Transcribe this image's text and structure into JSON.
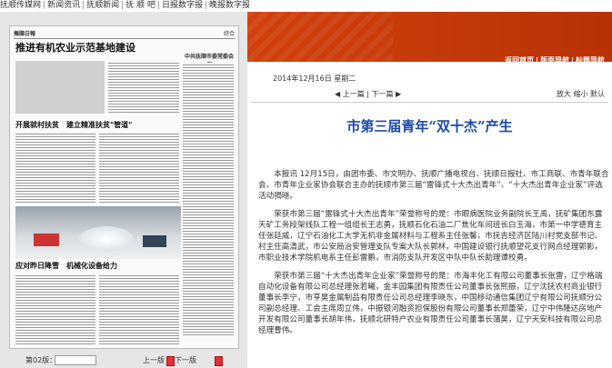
{
  "top_nav": [
    "抚顺传媒网",
    "新闻资讯",
    "抚顺新闻",
    "抚 顺 吧",
    "日报数字报",
    "晚报数字报"
  ],
  "paper_preview": {
    "masthead": "撫順日報",
    "section": "综合",
    "headline_main": "推进有机农业示范基地建设",
    "headline_mid": "开展就村扶贫　建立精准扶贫\"管道\"",
    "headline_photo": "应对昨日降雪　机械化设备给力",
    "side_headline": "中共抚顺市委常委会议"
  },
  "page_nav": {
    "page_label": "第02版：",
    "prev": "上一版",
    "next": "下一版"
  },
  "header_nav": [
    "返回首页",
    "版面导航",
    "标题导航"
  ],
  "article": {
    "date": "2014年12月16日 星期二",
    "prev": "上一篇",
    "next": "下一篇",
    "tools": "放大 缩小 默认",
    "title": "市第三届青年“双十杰”产生",
    "paragraphs": [
      "本报讯 12月15日，由团市委、市文明办、抚顺广播电视台、抚顺日报社、市工商联、市青年联合会、市青年企业家协会联合主办的抚顺市第三届“雷锋式十大杰出青年”、“十大杰出青年企业家”评选活动揭晓。",
      "荣获市第三届“雷锋式十大杰出青年”荣誉称号的是：市眼病医院业务副院长王禹，抚矿集团东露天矿工务段架线队工程一组组长王志勇，抚顺石化石油二厂焦化车间班长白玉海，市第一中学德育主任张廷威，辽宁石油化工大学无机非金属材料与工程系主任张馨，市抚吉经济区陆川村党支部书记、村主任高清武，市公安局治安管理支队专案大队长郭林，中国建设银行抚顺望花支行网点经理郭影，市职业技术学院机电系主任彭雷鹏，市消防支队开发区中队中队长助理谭校勇。",
      "荣获市第三届“十大杰出青年企业家”荣誉称号的是：市海丰化工有限公司董事长张雷，辽宁格瑞自动化设备有限公司总经理张若曦，金丰园集团有限责任公司董事长张熙振，辽宁沈抚农村商业银行董事长李宁，市亨昊金属制品有限责任公司总经理李晓东，中国移动通信集团辽宁有限公司抚顺分公司副总经理、工会主席周立伟，中振银河融资担保股份有限公司董事长郑蕾荣，辽宁中伟隆达房地产开发有限公司董事长胡年伟，抚顺北研特产农业有限责任公司董事长蒲昊，辽宁天安科技有限公司总经理曹伟。"
    ]
  }
}
